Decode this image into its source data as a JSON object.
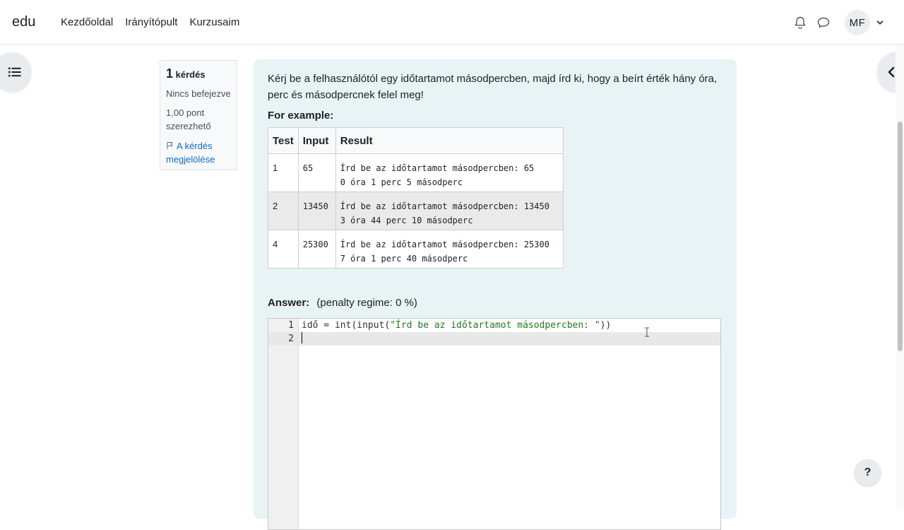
{
  "navbar": {
    "brand": "edu",
    "links": [
      "Kezdőoldal",
      "Irányítópult",
      "Kurzusaim"
    ],
    "avatar_initials": "MF"
  },
  "question_info": {
    "number": "1",
    "number_label": "kérdés",
    "state": "Nincs befejezve",
    "grade": "1,00 pont szerezhető",
    "flag": "A kérdés megjelölése"
  },
  "question": {
    "text": "Kérj be a felhasználótól egy időtartamot másodpercben, majd írd ki, hogy a beírt érték hány óra, perc és másodpercnek felel meg!",
    "example_label": "For example:",
    "table": {
      "headers": [
        "Test",
        "Input",
        "Result"
      ],
      "rows": [
        {
          "test": "1",
          "input": "65",
          "result_line1": "Írd be az időtartamot másodpercben: 65",
          "result_line2": "0 óra 1 perc 5 másodperc"
        },
        {
          "test": "2",
          "input": "13450",
          "result_line1": "Írd be az időtartamot másodpercben: 13450",
          "result_line2": "3 óra 44 perc 10 másodperc"
        },
        {
          "test": "4",
          "input": "25300",
          "result_line1": "Írd be az időtartamot másodpercben: 25300",
          "result_line2": "7 óra 1 perc 40 másodperc"
        }
      ]
    },
    "answer_label": "Answer:",
    "penalty": "(penalty regime: 0 %)"
  },
  "editor": {
    "lines": [
      {
        "num": "1",
        "before": "idő = int(input(",
        "string": "\"Írd be az időtartamot másodpercben: \"",
        "after": "))"
      },
      {
        "num": "2",
        "before": "",
        "string": "",
        "after": ""
      }
    ]
  },
  "help_label": "?",
  "colors": {
    "content_bg": "#e7f3f5",
    "link": "#0f6cbf",
    "string": "#237a1f"
  }
}
